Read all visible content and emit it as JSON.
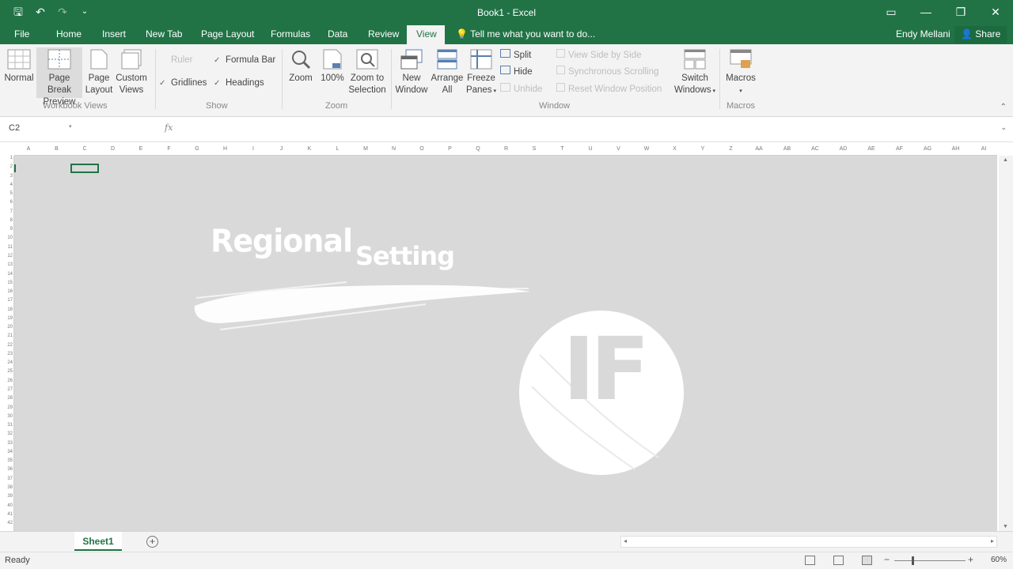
{
  "titlebar": {
    "title": "Book1 - Excel",
    "qat": [
      {
        "name": "save-icon",
        "glyph": "🖫"
      },
      {
        "name": "undo-icon",
        "glyph": "↶"
      },
      {
        "name": "redo-icon",
        "glyph": "↷"
      },
      {
        "name": "customize-qat-icon",
        "glyph": "⌄"
      }
    ],
    "controls": [
      {
        "name": "ribbon-display-options-icon",
        "glyph": "▭"
      },
      {
        "name": "minimize-icon",
        "glyph": "—"
      },
      {
        "name": "restore-icon",
        "glyph": "❐"
      },
      {
        "name": "close-icon",
        "glyph": "✕"
      }
    ]
  },
  "tabs": {
    "file": "File",
    "home": "Home",
    "insert": "Insert",
    "newtab": "New Tab",
    "pagelayout": "Page Layout",
    "formulas": "Formulas",
    "data": "Data",
    "review": "Review",
    "view": "View",
    "tellme": "Tell me what you want to do...",
    "user": "Endy Mellani",
    "share": "Share"
  },
  "ribbon": {
    "normal": "Normal",
    "pagebreak": [
      "Page Break",
      "Preview"
    ],
    "pagelayout": [
      "Page",
      "Layout"
    ],
    "customviews": [
      "Custom",
      "Views"
    ],
    "workbook_views_label": "Workbook Views",
    "ruler": "Ruler",
    "formulabar": "Formula Bar",
    "gridlines": "Gridlines",
    "headings": "Headings",
    "show_label": "Show",
    "zoom": "Zoom",
    "zoom100": "100%",
    "zoomsel": [
      "Zoom to",
      "Selection"
    ],
    "zoom_label": "Zoom",
    "newwindow": [
      "New",
      "Window"
    ],
    "arrangeall": [
      "Arrange",
      "All"
    ],
    "freeze": [
      "Freeze",
      "Panes"
    ],
    "split": "Split",
    "hide": "Hide",
    "unhide": "Unhide",
    "viewside": "View Side by Side",
    "syncscroll": "Synchronous Scrolling",
    "resetwin": "Reset Window Position",
    "switch": [
      "Switch",
      "Windows"
    ],
    "window_label": "Window",
    "macros": "Macros",
    "macros_label": "Macros"
  },
  "formula": {
    "namebox": "C2",
    "fx": "fx"
  },
  "columns": [
    "A",
    "B",
    "C",
    "D",
    "E",
    "F",
    "G",
    "H",
    "I",
    "J",
    "K",
    "L",
    "M",
    "N",
    "O",
    "P",
    "Q",
    "R",
    "S",
    "T",
    "U",
    "V",
    "W",
    "X",
    "Y",
    "Z",
    "AA",
    "AB",
    "AC",
    "AD",
    "AE",
    "AF",
    "AG",
    "AH",
    "AI"
  ],
  "rows": [
    "1",
    "2",
    "3",
    "4",
    "5",
    "6",
    "7",
    "8",
    "9",
    "10",
    "11",
    "12",
    "13",
    "14",
    "15",
    "16",
    "17",
    "18",
    "19",
    "20",
    "21",
    "22",
    "23",
    "24",
    "25",
    "26",
    "27",
    "28",
    "29",
    "30",
    "31",
    "32",
    "33",
    "34",
    "35",
    "36",
    "37",
    "38",
    "39",
    "40",
    "41",
    "42"
  ],
  "overlay": {
    "word1": "Regional",
    "word2": "Setting",
    "logo": "IF"
  },
  "sheets": {
    "active": "Sheet1"
  },
  "status": {
    "text": "Ready",
    "zoom": "60%"
  },
  "colors": {
    "accent": "#217346",
    "overlay_bg": "#d9d9d9"
  }
}
